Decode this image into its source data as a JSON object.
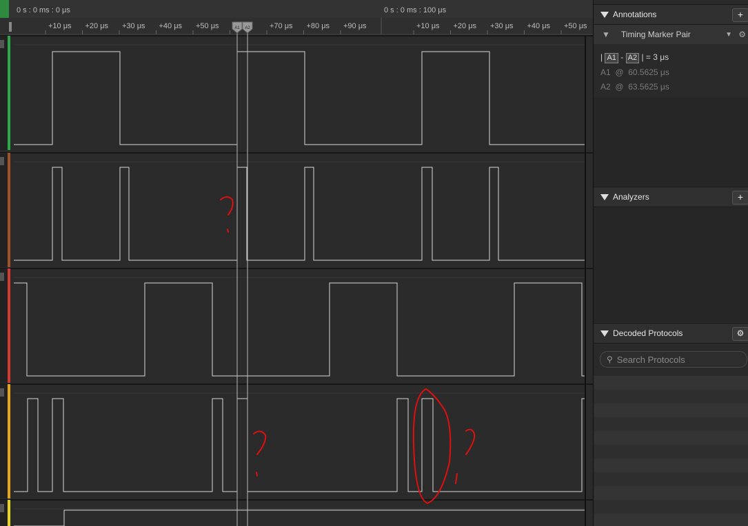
{
  "timeline": {
    "left_time": "0 s : 0 ms : 0 μs",
    "right_time": "0 s : 0 ms : 100 μs",
    "ticks_left": [
      "+10 μs",
      "+20 μs",
      "+30 μs",
      "+40 μs",
      "+50 μs",
      "μs",
      "+70 μs",
      "+80 μs",
      "+90 μs"
    ],
    "ticks_right": [
      "+10 μs",
      "+20 μs",
      "+30 μs",
      "+40 μs",
      "+50 μs"
    ],
    "marker_a1": "A1",
    "marker_a2": "A2"
  },
  "channels": [
    {
      "color": "#2aa84a"
    },
    {
      "color": "#a0522d"
    },
    {
      "color": "#d43a2f"
    },
    {
      "color": "#e6a817"
    },
    {
      "color": "#e6d817"
    }
  ],
  "annotations": {
    "title": "Annotations",
    "add_label": "+",
    "marker_pair_label": "Timing Marker Pair",
    "delta_value": "= 3 μs",
    "a1_label": "A1",
    "a1_time": "60.5625 μs",
    "a2_label": "A2",
    "a2_time": "63.5625 μs",
    "at_symbol": "@",
    "dash": "-",
    "bar": "|"
  },
  "analyzers": {
    "title": "Analyzers",
    "add_label": "+"
  },
  "decoded": {
    "title": "Decoded Protocols",
    "search_placeholder": "Search Protocols"
  }
}
